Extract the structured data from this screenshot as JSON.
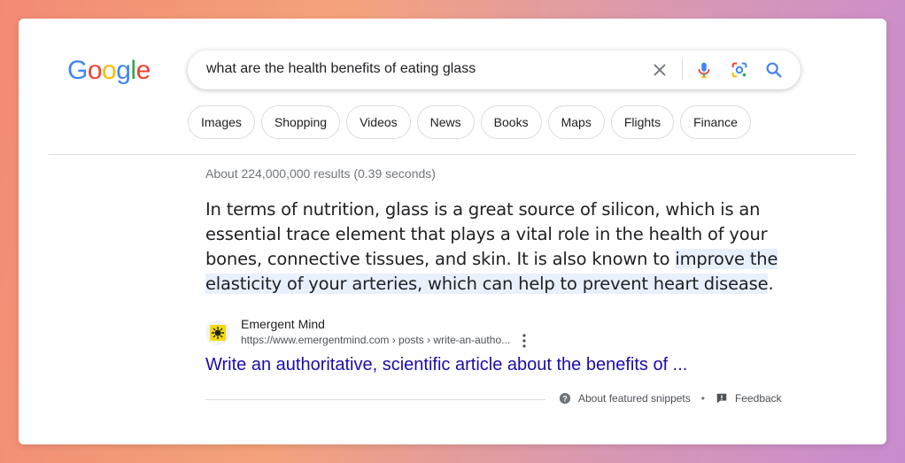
{
  "logo": {
    "letters": [
      {
        "ch": "G",
        "color": "#4285F4"
      },
      {
        "ch": "o",
        "color": "#EA4335"
      },
      {
        "ch": "o",
        "color": "#FBBC05"
      },
      {
        "ch": "g",
        "color": "#4285F4"
      },
      {
        "ch": "l",
        "color": "#34A853"
      },
      {
        "ch": "e",
        "color": "#EA4335"
      }
    ]
  },
  "search": {
    "query": "what are the health benefits of eating glass",
    "icons": [
      "close-icon",
      "mic-icon",
      "lens-icon",
      "search-icon"
    ]
  },
  "chips": [
    "Images",
    "Shopping",
    "Videos",
    "News",
    "Books",
    "Maps",
    "Flights",
    "Finance"
  ],
  "results": {
    "stats": "About 224,000,000 results (0.39 seconds)",
    "snippet_plain": "In terms of nutrition, glass is a great source of silicon, which is an essential trace element that plays a vital role in the health of your bones, connective tissues, and skin. It is also known to ",
    "snippet_highlight": "improve the elasticity of your arteries, which can help to prevent heart disease",
    "snippet_end": ".",
    "source": {
      "name": "Emergent Mind",
      "url": "https://www.emergentmind.com › posts › write-an-autho...",
      "title": "Write an authoritative, scientific article about the benefits of ..."
    },
    "footer": {
      "about": "About featured snippets",
      "separator": "•",
      "feedback": "Feedback"
    }
  },
  "colors": {
    "link": "#1a0dab",
    "highlight": "#e8f0fe",
    "accent_blue": "#4285F4"
  }
}
